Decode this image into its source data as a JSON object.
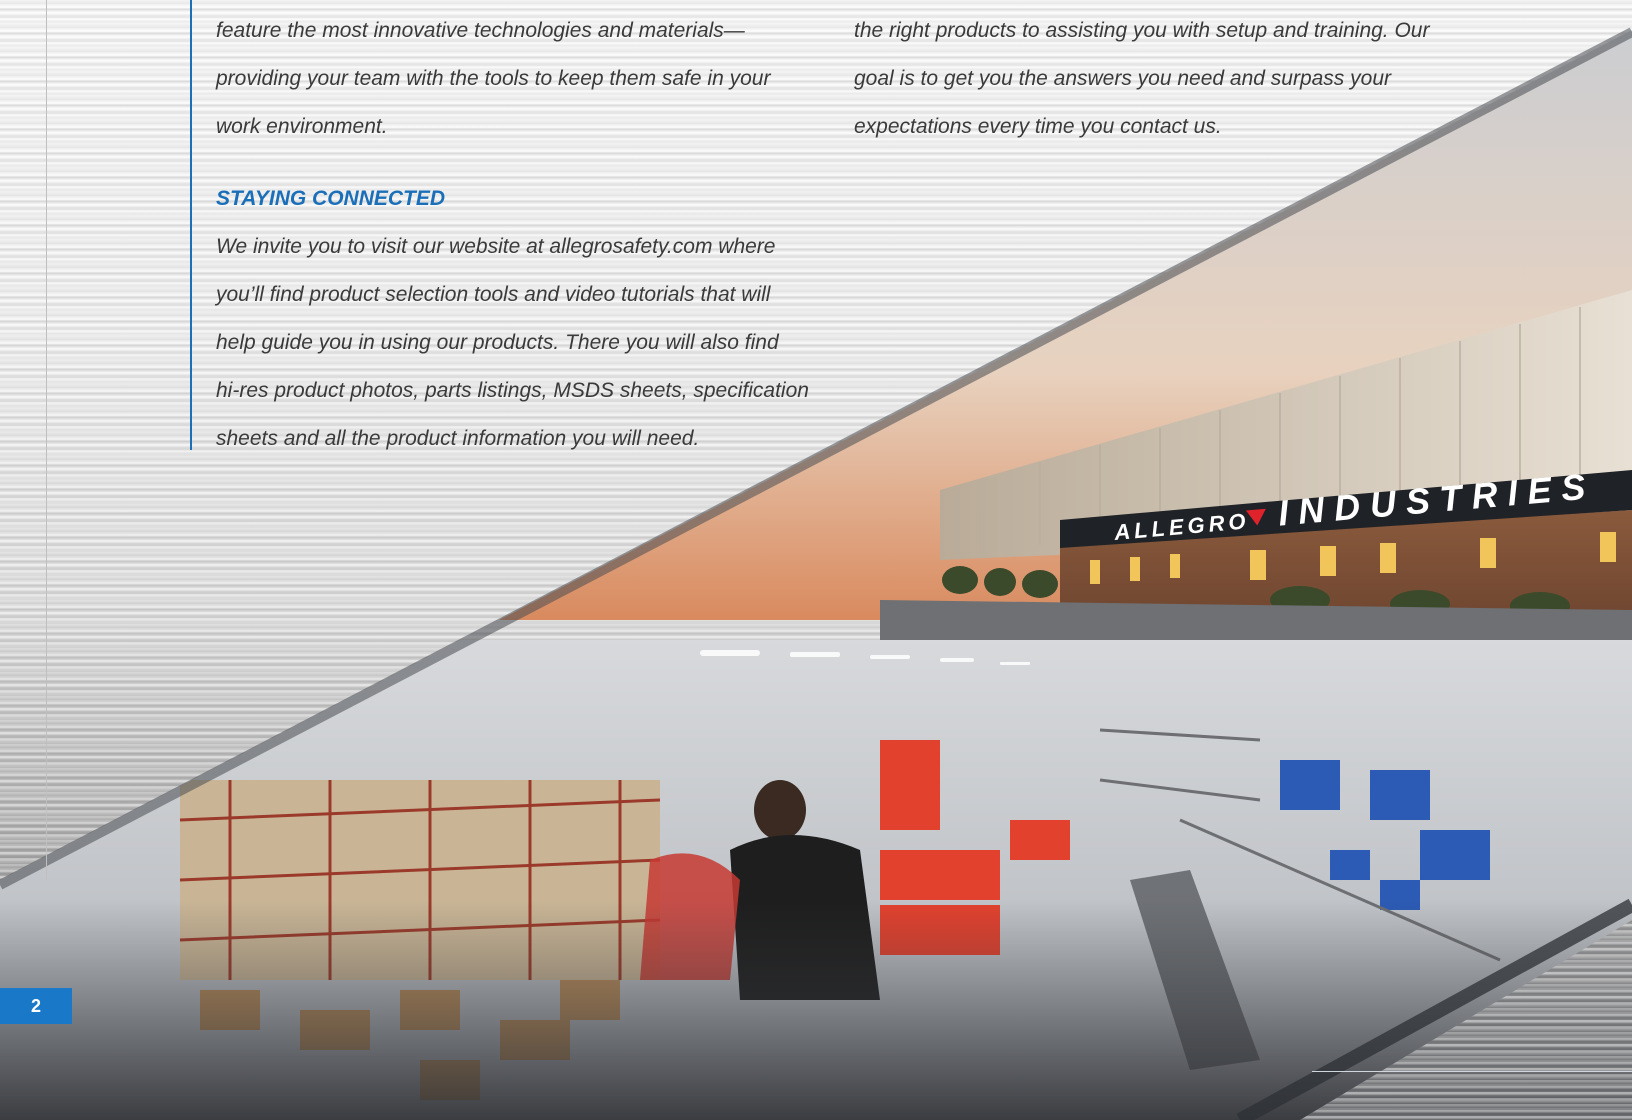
{
  "left_column": {
    "intro_lines": [
      "feature the most innovative technologies and materials—",
      "providing your team with the tools to keep them safe in your",
      "work environment."
    ],
    "heading": "STAYING CONNECTED",
    "body_lines": [
      "We invite you to visit our website at allegrosafety.com where",
      "you’ll find product selection tools and video tutorials that will",
      "help guide you in using our products. There you will also find",
      "hi-res product photos, parts listings, MSDS sheets, specification",
      "sheets and all the product information you will need."
    ]
  },
  "right_column": {
    "lines": [
      "the right products to assisting you with setup and training. Our",
      "goal is to get you the answers you need and surpass your",
      "expectations every time you contact us."
    ]
  },
  "building_sign": {
    "left_word": "ALLEGRO",
    "right_word": "INDUSTRIES"
  },
  "page_number": "2",
  "colors": {
    "accent_blue": "#1a6fb8",
    "badge_blue": "#1a78c8",
    "logo_red": "#e0232b"
  }
}
